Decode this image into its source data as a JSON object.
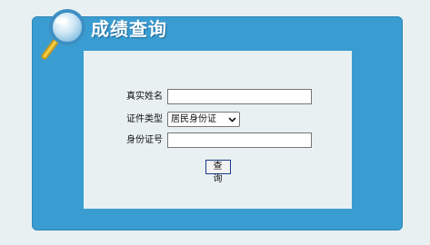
{
  "panel": {
    "title": "成绩查询"
  },
  "form": {
    "name_label": "真实姓名",
    "name_value": "",
    "id_type_label": "证件类型",
    "id_type_selected": "居民身份证",
    "id_number_label": "身份证号",
    "id_number_value": ""
  },
  "actions": {
    "query_label": "查 询"
  },
  "icons": {
    "title_icon": "magnifier-icon",
    "select_arrow": "chevron-down-icon"
  },
  "colors": {
    "panel_blue": "#3a9dd2",
    "page_bg": "#e9f0f1",
    "inner_bg": "#e8f0f2"
  }
}
